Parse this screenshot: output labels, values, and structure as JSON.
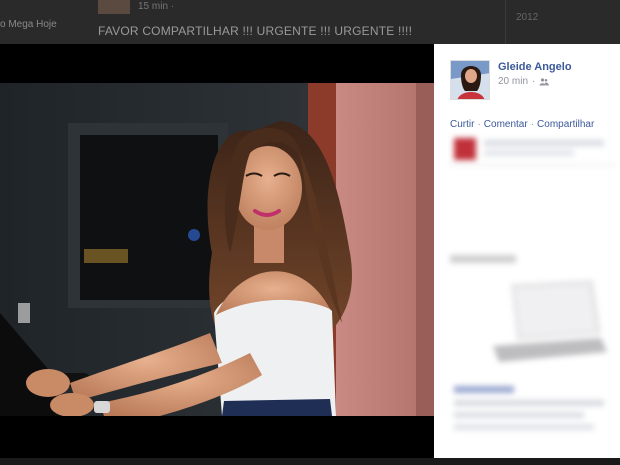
{
  "background_feed": {
    "left_name_fragment": "o Mega Hoje",
    "post_time": "15 min · ",
    "post_text": "FAVOR COMPARTILHAR !!! URGENTE !!! URGENTE !!!!",
    "right_year": "2012"
  },
  "post": {
    "author_name": "Gleide Angelo",
    "time": "20 min",
    "audience_icon": "friends-icon",
    "actions": {
      "like": "Curtir",
      "comment": "Comentar",
      "share": "Compartilhar",
      "separator": "·"
    }
  },
  "colors": {
    "link_blue": "#3b5998",
    "meta_gray": "#90949c",
    "panel_bg": "#ffffff",
    "overlay_bg": "#000000"
  }
}
